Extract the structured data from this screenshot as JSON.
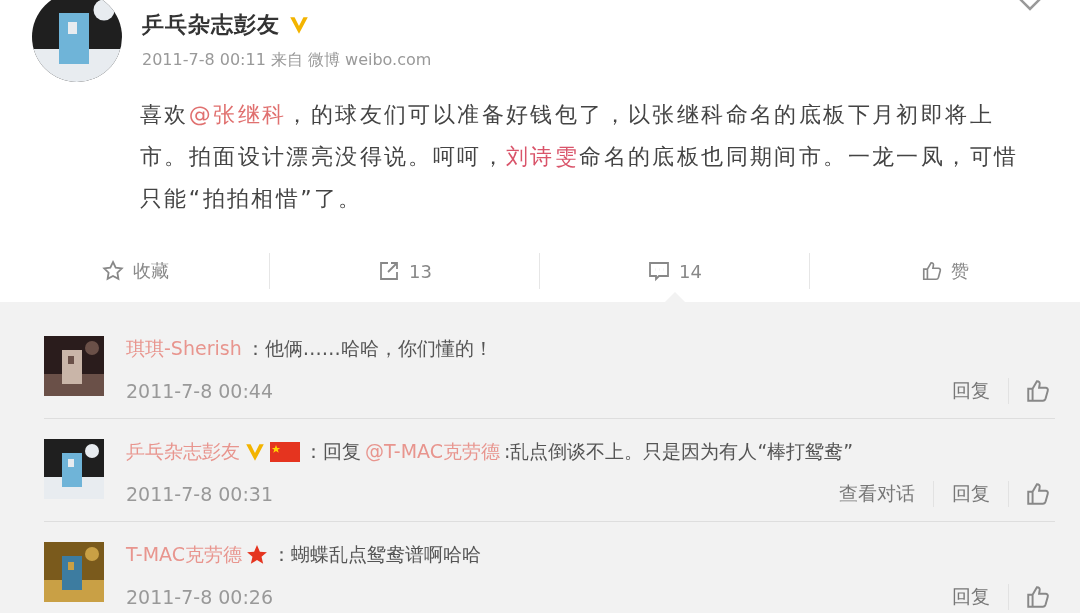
{
  "post": {
    "author": "乒乓杂志彭友",
    "verified": true,
    "meta": "2011-7-8 00:11 来自 微博 weibo.com",
    "body": [
      {
        "kind": "plain",
        "text": "喜欢"
      },
      {
        "kind": "mention",
        "text": "@张继科"
      },
      {
        "kind": "plain",
        "text": "，的球友们可以准备好钱包了，以张继科命名的底板下月初即将上市。拍面设计漂亮没得说。呵呵，"
      },
      {
        "kind": "highlight",
        "text": "刘诗雯"
      },
      {
        "kind": "plain",
        "text": "命名的底板也同期间市。一龙一凤，可惜只能“拍拍相惜”了。"
      }
    ]
  },
  "actions": [
    {
      "kind": "favorite",
      "label": "收藏",
      "selected": false
    },
    {
      "kind": "repost",
      "label": "13",
      "selected": false
    },
    {
      "kind": "comment",
      "label": "14",
      "selected": true
    },
    {
      "kind": "like",
      "label": "赞",
      "selected": false
    }
  ],
  "comments": [
    {
      "author": "琪琪-Sherish",
      "verified": false,
      "flag": false,
      "star": false,
      "content": [
        {
          "kind": "plain",
          "text": "：他俩……哈哈，你们懂的！"
        }
      ],
      "time": "2011-7-8 00:44",
      "links": [
        "回复"
      ]
    },
    {
      "author": "乒乓杂志彭友",
      "verified": true,
      "flag": true,
      "star": false,
      "content": [
        {
          "kind": "plain",
          "text": "：回复"
        },
        {
          "kind": "mention",
          "text": "@T-MAC克劳德"
        },
        {
          "kind": "plain",
          "text": ":乱点倒谈不上。只是因为有人“棒打鸳鸯”"
        }
      ],
      "time": "2011-7-8 00:31",
      "links": [
        "查看对话",
        "回复"
      ]
    },
    {
      "author": "T-MAC克劳德",
      "verified": false,
      "flag": false,
      "star": true,
      "content": [
        {
          "kind": "plain",
          "text": "：蝴蝶乱点鸳鸯谱啊哈哈"
        }
      ],
      "time": "2011-7-8 00:26",
      "links": [
        "回复"
      ]
    }
  ]
}
